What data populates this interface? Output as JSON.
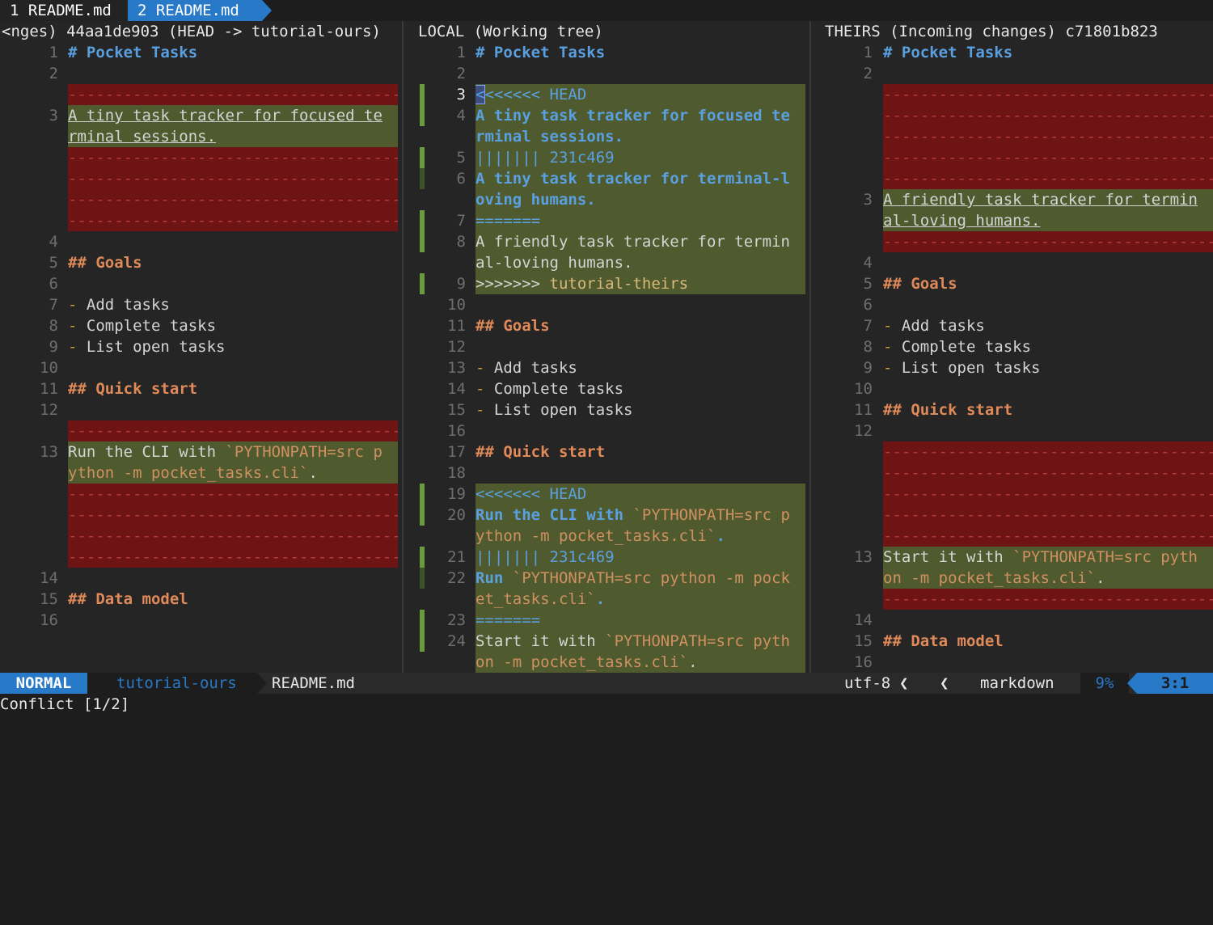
{
  "tabs": [
    {
      "number": "1",
      "label": "README.md"
    },
    {
      "number": "2",
      "label": "README.md"
    }
  ],
  "panes": {
    "base": {
      "title": "<nges) 44aa1de903 (HEAD -> tutorial-ours)",
      "lines": [
        {
          "n": "1",
          "text": "# Pocket Tasks",
          "style": "blue"
        },
        {
          "n": "2",
          "text": "",
          "style": "plain"
        },
        {
          "n": "",
          "text": "------------------------------------",
          "style": "del"
        },
        {
          "n": "3",
          "text": "A tiny task tracker for focused te",
          "style": "addu"
        },
        {
          "n": "",
          "text": "rminal sessions.",
          "style": "addu-end"
        },
        {
          "n": "",
          "text": "------------------------------------",
          "style": "del"
        },
        {
          "n": "",
          "text": "------------------------------------",
          "style": "del"
        },
        {
          "n": "",
          "text": "------------------------------------",
          "style": "del"
        },
        {
          "n": "",
          "text": "------------------------------------",
          "style": "del"
        },
        {
          "n": "4",
          "text": "",
          "style": "plain"
        },
        {
          "n": "5",
          "text": "## Goals",
          "style": "kw"
        },
        {
          "n": "6",
          "text": "",
          "style": "plain"
        },
        {
          "n": "7",
          "text": "- Add tasks",
          "style": "bullet"
        },
        {
          "n": "8",
          "text": "- Complete tasks",
          "style": "bullet"
        },
        {
          "n": "9",
          "text": "- List open tasks",
          "style": "bullet"
        },
        {
          "n": "10",
          "text": "",
          "style": "plain"
        },
        {
          "n": "11",
          "text": "## Quick start",
          "style": "kw"
        },
        {
          "n": "12",
          "text": "",
          "style": "plain"
        },
        {
          "n": "",
          "text": "------------------------------------",
          "style": "del"
        },
        {
          "n": "13",
          "text": "Run the CLI with `PYTHONPATH=src p",
          "style": "add-code"
        },
        {
          "n": "",
          "text": "ython -m pocket_tasks.cli`.",
          "style": "add-code2"
        },
        {
          "n": "",
          "text": "------------------------------------",
          "style": "del"
        },
        {
          "n": "",
          "text": "------------------------------------",
          "style": "del"
        },
        {
          "n": "",
          "text": "------------------------------------",
          "style": "del"
        },
        {
          "n": "",
          "text": "------------------------------------",
          "style": "del"
        },
        {
          "n": "14",
          "text": "",
          "style": "plain"
        },
        {
          "n": "15",
          "text": "## Data model",
          "style": "kw"
        },
        {
          "n": "16",
          "text": "",
          "style": "plain"
        }
      ]
    },
    "local": {
      "title": "LOCAL (Working tree)",
      "lines": [
        {
          "n": "1",
          "text": "# Pocket Tasks",
          "style": "blue",
          "sign": ""
        },
        {
          "n": "2",
          "text": "",
          "style": "plain",
          "sign": ""
        },
        {
          "n": "3",
          "text": "<<<<<<< HEAD",
          "style": "marker-head",
          "sign": "g",
          "cur": true
        },
        {
          "n": "4",
          "text": "A tiny task tracker for focused te",
          "style": "add-blue",
          "sign": "g"
        },
        {
          "n": "",
          "text": "rminal sessions.",
          "style": "add-blue",
          "sign": ""
        },
        {
          "n": "5",
          "text": "||||||| 231c469",
          "style": "marker",
          "sign": "g"
        },
        {
          "n": "6",
          "text": "A tiny task tracker for terminal-l",
          "style": "add-blue",
          "sign": "d"
        },
        {
          "n": "",
          "text": "oving humans.",
          "style": "add-blue",
          "sign": ""
        },
        {
          "n": "7",
          "text": "=======",
          "style": "marker",
          "sign": "g"
        },
        {
          "n": "8",
          "text": "A friendly task tracker for termin",
          "style": "add-plain",
          "sign": "g"
        },
        {
          "n": "",
          "text": "al-loving humans.",
          "style": "add-plain",
          "sign": ""
        },
        {
          "n": "9",
          "text": ">>>>>>> tutorial-theirs",
          "style": "marker-theirs",
          "sign": "g"
        },
        {
          "n": "10",
          "text": "",
          "style": "plain",
          "sign": ""
        },
        {
          "n": "11",
          "text": "## Goals",
          "style": "kw",
          "sign": ""
        },
        {
          "n": "12",
          "text": "",
          "style": "plain",
          "sign": ""
        },
        {
          "n": "13",
          "text": "- Add tasks",
          "style": "bullet",
          "sign": ""
        },
        {
          "n": "14",
          "text": "- Complete tasks",
          "style": "bullet",
          "sign": ""
        },
        {
          "n": "15",
          "text": "- List open tasks",
          "style": "bullet",
          "sign": ""
        },
        {
          "n": "16",
          "text": "",
          "style": "plain",
          "sign": ""
        },
        {
          "n": "17",
          "text": "## Quick start",
          "style": "kw",
          "sign": ""
        },
        {
          "n": "18",
          "text": "",
          "style": "plain",
          "sign": ""
        },
        {
          "n": "19",
          "text": "<<<<<<< HEAD",
          "style": "marker",
          "sign": "g"
        },
        {
          "n": "20",
          "text": "Run the CLI with `PYTHONPATH=src p",
          "style": "add-blue-code",
          "sign": "g"
        },
        {
          "n": "",
          "text": "ython -m pocket_tasks.cli`.",
          "style": "add-blue-code2",
          "sign": ""
        },
        {
          "n": "21",
          "text": "||||||| 231c469",
          "style": "marker",
          "sign": "g"
        },
        {
          "n": "22",
          "text": "Run `PYTHONPATH=src python -m pock",
          "style": "add-blue-code3",
          "sign": "d"
        },
        {
          "n": "",
          "text": "et_tasks.cli`.",
          "style": "add-blue-code4",
          "sign": ""
        },
        {
          "n": "23",
          "text": "=======",
          "style": "marker",
          "sign": "g"
        },
        {
          "n": "24",
          "text": "Start it with `PYTHONPATH=src pyth",
          "style": "add-code5",
          "sign": "g"
        },
        {
          "n": "",
          "text": "on -m pocket_tasks.cli`.",
          "style": "add-code6",
          "sign": ""
        }
      ]
    },
    "theirs": {
      "title": "THEIRS (Incoming changes) c71801b823",
      "lines": [
        {
          "n": "1",
          "text": "# Pocket Tasks",
          "style": "blue"
        },
        {
          "n": "2",
          "text": "",
          "style": "plain"
        },
        {
          "n": "",
          "text": "-------------------------------------",
          "style": "del"
        },
        {
          "n": "",
          "text": "-------------------------------------",
          "style": "del"
        },
        {
          "n": "",
          "text": "-------------------------------------",
          "style": "del"
        },
        {
          "n": "",
          "text": "-------------------------------------",
          "style": "del"
        },
        {
          "n": "",
          "text": "-------------------------------------",
          "style": "del"
        },
        {
          "n": "3",
          "text": "A friendly task tracker for termin",
          "style": "addu"
        },
        {
          "n": "",
          "text": "al-loving humans.",
          "style": "addu-end"
        },
        {
          "n": "",
          "text": "-------------------------------------",
          "style": "del"
        },
        {
          "n": "4",
          "text": "",
          "style": "plain"
        },
        {
          "n": "5",
          "text": "## Goals",
          "style": "kw"
        },
        {
          "n": "6",
          "text": "",
          "style": "plain"
        },
        {
          "n": "7",
          "text": "- Add tasks",
          "style": "bullet"
        },
        {
          "n": "8",
          "text": "- Complete tasks",
          "style": "bullet"
        },
        {
          "n": "9",
          "text": "- List open tasks",
          "style": "bullet"
        },
        {
          "n": "10",
          "text": "",
          "style": "plain"
        },
        {
          "n": "11",
          "text": "## Quick start",
          "style": "kw"
        },
        {
          "n": "12",
          "text": "",
          "style": "plain"
        },
        {
          "n": "",
          "text": "-------------------------------------",
          "style": "del"
        },
        {
          "n": "",
          "text": "-------------------------------------",
          "style": "del"
        },
        {
          "n": "",
          "text": "-------------------------------------",
          "style": "del"
        },
        {
          "n": "",
          "text": "-------------------------------------",
          "style": "del"
        },
        {
          "n": "",
          "text": "-------------------------------------",
          "style": "del"
        },
        {
          "n": "13",
          "text": "Start it with `PYTHONPATH=src pyth",
          "style": "add-code5"
        },
        {
          "n": "",
          "text": "on -m pocket_tasks.cli`.",
          "style": "add-code6"
        },
        {
          "n": "",
          "text": "-------------------------------------",
          "style": "del"
        },
        {
          "n": "14",
          "text": "",
          "style": "plain"
        },
        {
          "n": "15",
          "text": "## Data model",
          "style": "kw"
        },
        {
          "n": "16",
          "text": "",
          "style": "plain"
        }
      ]
    }
  },
  "statusline": {
    "mode": "NORMAL",
    "branch_icon": "git-branch-icon",
    "branch": "tutorial-ours",
    "filename": "README.md",
    "encoding": "utf-8",
    "os_icon": "linux-icon",
    "filetype_icon": "file-icon",
    "filetype": "markdown",
    "percent": "9%",
    "position": "3:1"
  },
  "message": "Conflict [1/2]",
  "colors": {
    "accent": "#2879c8",
    "add_bg": "#4f5b2f",
    "del_bg": "#6e1414",
    "sign_green": "#6a9a3e"
  }
}
